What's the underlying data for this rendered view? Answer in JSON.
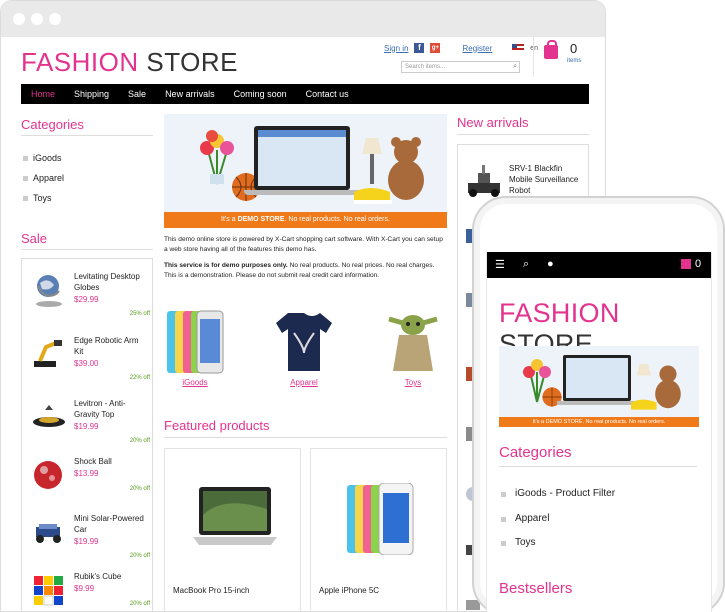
{
  "store": {
    "logo_a": "FASHION",
    "logo_b": " STORE"
  },
  "header": {
    "sign_in": "Sign in",
    "register": "Register",
    "lang": "en",
    "search_placeholder": "Search items...",
    "cart_count": "0",
    "cart_label": "items"
  },
  "nav": [
    "Home",
    "Shipping",
    "Sale",
    "New arrivals",
    "Coming soon",
    "Contact us"
  ],
  "categories_title": "Categories",
  "categories": [
    "iGoods",
    "Apparel",
    "Toys"
  ],
  "sale_title": "Sale",
  "sale_items": [
    {
      "name": "Levitating Desktop Globes",
      "price": "$29.99",
      "off": "25% off"
    },
    {
      "name": "Edge Robotic Arm Kit",
      "price": "$39.00",
      "off": "22% off"
    },
    {
      "name": "Levitron - Anti-Gravity Top",
      "price": "$19.99",
      "off": "20% off"
    },
    {
      "name": "Shock Ball",
      "price": "$13.99",
      "off": "20% off"
    },
    {
      "name": "Mini Solar-Powered Car",
      "price": "$19.99",
      "off": "20% off"
    },
    {
      "name": "Rubik's Cube",
      "price": "$9.99",
      "off": "20% off"
    }
  ],
  "banner": {
    "strip_pre": "It's a ",
    "strip_bold": "DEMO STORE",
    "strip_post": ". No real products. No real orders."
  },
  "intro": {
    "p1": "This demo online store is powered by X-Cart shopping cart software. With X-Cart you can setup a web store having all of the features this demo has.",
    "p2_bold": "This service is for demo purposes only.",
    "p2": " No real products. No real prices. No real charges. This is a demonstration. Please do not submit real credit card information."
  },
  "cat_links": [
    "iGoods",
    "Apparel",
    "Toys"
  ],
  "featured_title": "Featured products",
  "featured": [
    "MacBook Pro 15-inch",
    "Apple iPhone 5C"
  ],
  "new_arrivals_title": "New arrivals",
  "new_arrivals": [
    "SRV-1 Blackfin Mobile Surveillance Robot"
  ],
  "mobile": {
    "cart_count": "0",
    "categories_title": "Categories",
    "categories": [
      "iGoods - Product Filter",
      "Apparel",
      "Toys"
    ],
    "bestsellers_title": "Bestsellers",
    "banner_strip": "It's a DEMO STORE. No real products. No real orders."
  },
  "colors": {
    "accent": "#e2338e",
    "nav_bg": "#000000",
    "strip": "#f07a1a",
    "link": "#3a6fb0"
  }
}
